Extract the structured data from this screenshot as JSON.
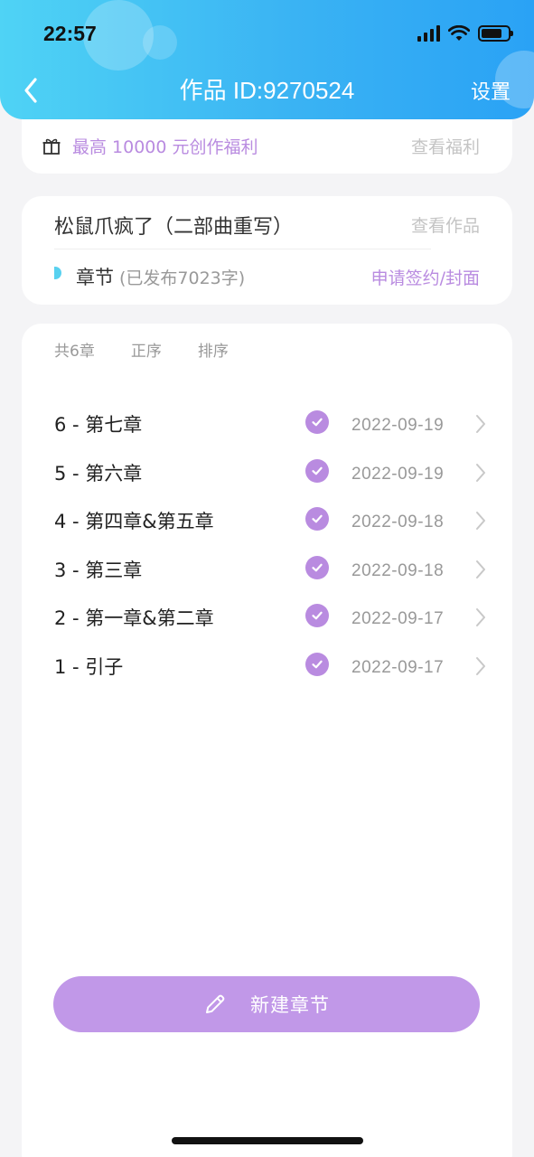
{
  "status_bar": {
    "time": "22:57"
  },
  "nav": {
    "title": "作品 ID:9270524",
    "settings_label": "设置",
    "back_icon": "chevron-left-icon"
  },
  "benefit": {
    "icon": "gift-icon",
    "text": "最高 10000 元创作福利",
    "link": "查看福利"
  },
  "work": {
    "title": "松鼠爪疯了（二部曲重写）",
    "view_link": "查看作品",
    "chapter_label": "章节",
    "published_text": "(已发布7023字)",
    "apply_link": "申请签约/封面"
  },
  "chapter_list": {
    "toolbar": {
      "count": "共6章",
      "order": "正序",
      "sort": "排序"
    },
    "rows": [
      {
        "name": "6 - 第七章",
        "date": "2022-09-19"
      },
      {
        "name": "5 - 第六章",
        "date": "2022-09-19"
      },
      {
        "name": "4 - 第四章&第五章",
        "date": "2022-09-18"
      },
      {
        "name": "3 - 第三章",
        "date": "2022-09-18"
      },
      {
        "name": "2 - 第一章&第二章",
        "date": "2022-09-17"
      },
      {
        "name": "1 - 引子",
        "date": "2022-09-17"
      }
    ]
  },
  "new_chapter_button": {
    "label": "新建章节",
    "icon": "pencil-icon"
  },
  "colors": {
    "header_gradient_start": "#4fd3f5",
    "header_gradient_end": "#2aa2f5",
    "accent_purple": "#b98be0",
    "button_purple": "#c198e8",
    "chapter_dot_cyan": "#58d1ef"
  }
}
